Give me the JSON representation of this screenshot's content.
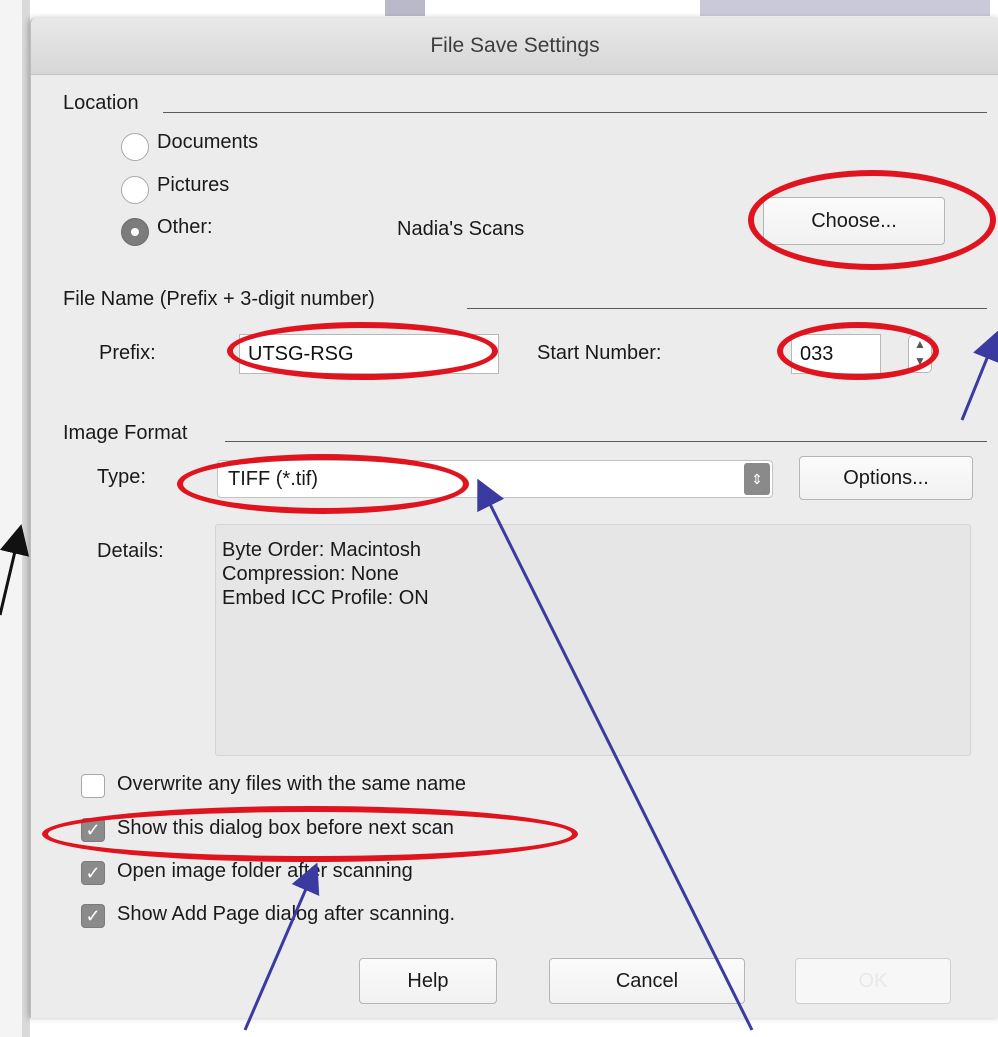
{
  "dialog": {
    "title": "File Save Settings"
  },
  "location": {
    "label": "Location",
    "options": [
      {
        "label": "Documents",
        "selected": false
      },
      {
        "label": "Pictures",
        "selected": false
      },
      {
        "label": "Other:",
        "selected": true
      }
    ],
    "other_value": "Nadia's Scans",
    "choose_label": "Choose..."
  },
  "file_name": {
    "label": "File Name (Prefix + 3-digit number)",
    "prefix_label": "Prefix:",
    "prefix_value": "UTSG-RSG",
    "start_label": "Start Number:",
    "start_value": "033"
  },
  "image_format": {
    "label": "Image Format",
    "type_label": "Type:",
    "type_value": "TIFF (*.tif)",
    "options_label": "Options...",
    "details_label": "Details:",
    "details": [
      "Byte Order: Macintosh",
      "Compression: None",
      "Embed ICC Profile: ON"
    ]
  },
  "checkboxes": [
    {
      "label": "Overwrite any files with the same name",
      "checked": false
    },
    {
      "label": "Show this dialog box before next scan",
      "checked": true
    },
    {
      "label": "Open image folder after scanning",
      "checked": true
    },
    {
      "label": "Show Add Page dialog after scanning.",
      "checked": true
    }
  ],
  "buttons": {
    "help": "Help",
    "cancel": "Cancel",
    "ok": "OK"
  },
  "colors": {
    "annotation_red": "#e0141e",
    "annotation_blue": "#3b3aa0",
    "dialog_bg": "#ececec"
  }
}
